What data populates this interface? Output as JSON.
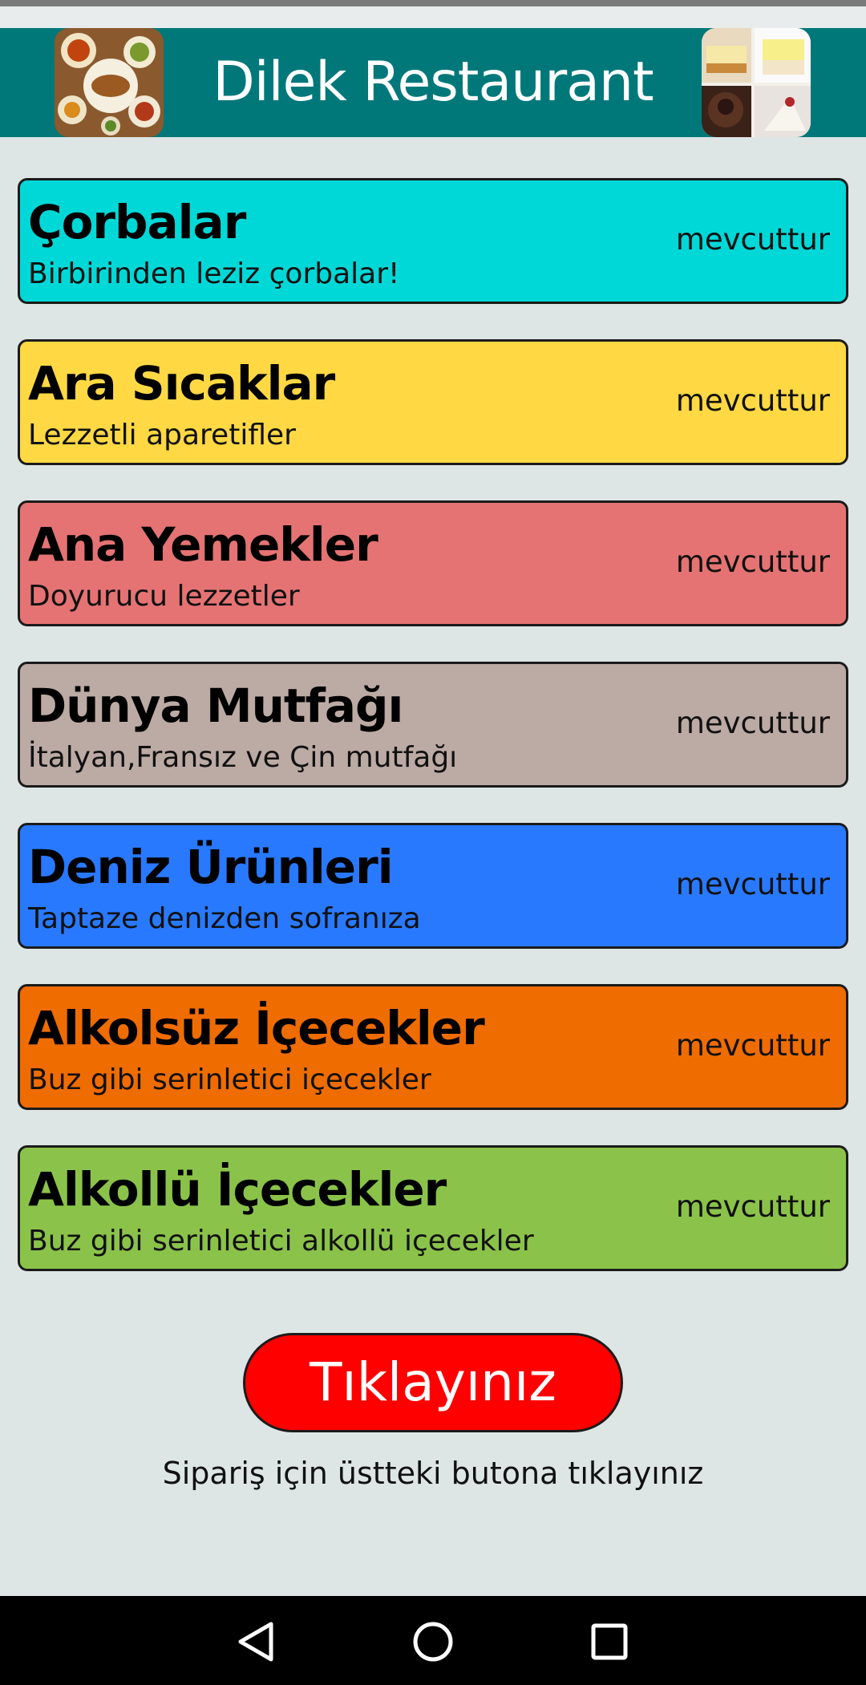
{
  "header": {
    "title": "Dilek Restaurant",
    "left_image": "food-platter-photo",
    "right_image": "desserts-photo",
    "background": "#00787a"
  },
  "menu": [
    {
      "title": "Çorbalar",
      "subtitle": "Birbirinden leziz çorbalar!",
      "status": "mevcuttur",
      "color": "#00d8d8"
    },
    {
      "title": "Ara Sıcaklar",
      "subtitle": "Lezzetli aparetifler",
      "status": "mevcuttur",
      "color": "#ffd843"
    },
    {
      "title": "Ana Yemekler",
      "subtitle": "Doyurucu lezzetler",
      "status": "mevcuttur",
      "color": "#e57373"
    },
    {
      "title": "Dünya Mutfağı",
      "subtitle": "İtalyan,Fransız ve Çin mutfağı",
      "status": "mevcuttur",
      "color": "#bcaaa4"
    },
    {
      "title": "Deniz Ürünleri",
      "subtitle": "Taptaze denizden sofranıza",
      "status": "mevcuttur",
      "color": "#2979ff"
    },
    {
      "title": "Alkolsüz İçecekler",
      "subtitle": "Buz gibi serinletici içecekler",
      "status": "mevcuttur",
      "color": "#ef6c00"
    },
    {
      "title": "Alkollü İçecekler",
      "subtitle": "Buz gibi serinletici alkollü içecekler",
      "status": "mevcuttur",
      "color": "#8bc34a"
    }
  ],
  "order_button": {
    "label": "Tıklayınız",
    "color": "#ff0000"
  },
  "hint_text": "Sipariş için üstteki butona tıklayınız",
  "navbar": {
    "back_icon": "back-triangle-icon",
    "home_icon": "home-circle-icon",
    "recent_icon": "recent-square-icon"
  }
}
